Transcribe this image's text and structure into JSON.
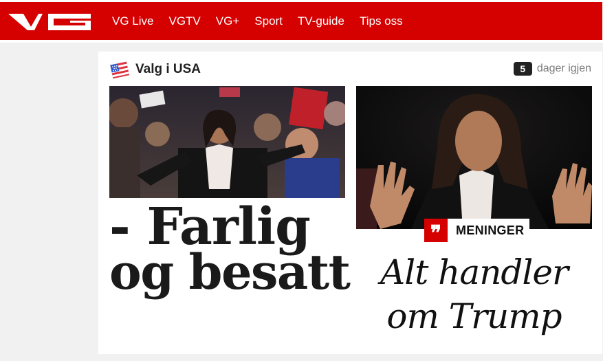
{
  "brand": {
    "logo_text": "VG",
    "color": "#d50000"
  },
  "nav": {
    "items": [
      "VG Live",
      "VGTV",
      "VG+",
      "Sport",
      "TV-guide",
      "Tips oss"
    ]
  },
  "section": {
    "title": "Valg i USA",
    "icon": "us-election-flag-icon",
    "countdown": {
      "number": "5",
      "label": "dager igjen"
    }
  },
  "articles": [
    {
      "image": "kamala-harris-rally-photo",
      "headline_line1": "- Farlig",
      "headline_line2": "og besatt"
    },
    {
      "image": "kamala-harris-speech-photo",
      "tag": {
        "icon": "quote-icon",
        "label": "MENINGER"
      },
      "headline_line1": "Alt handler",
      "headline_line2": "om Trump"
    }
  ]
}
